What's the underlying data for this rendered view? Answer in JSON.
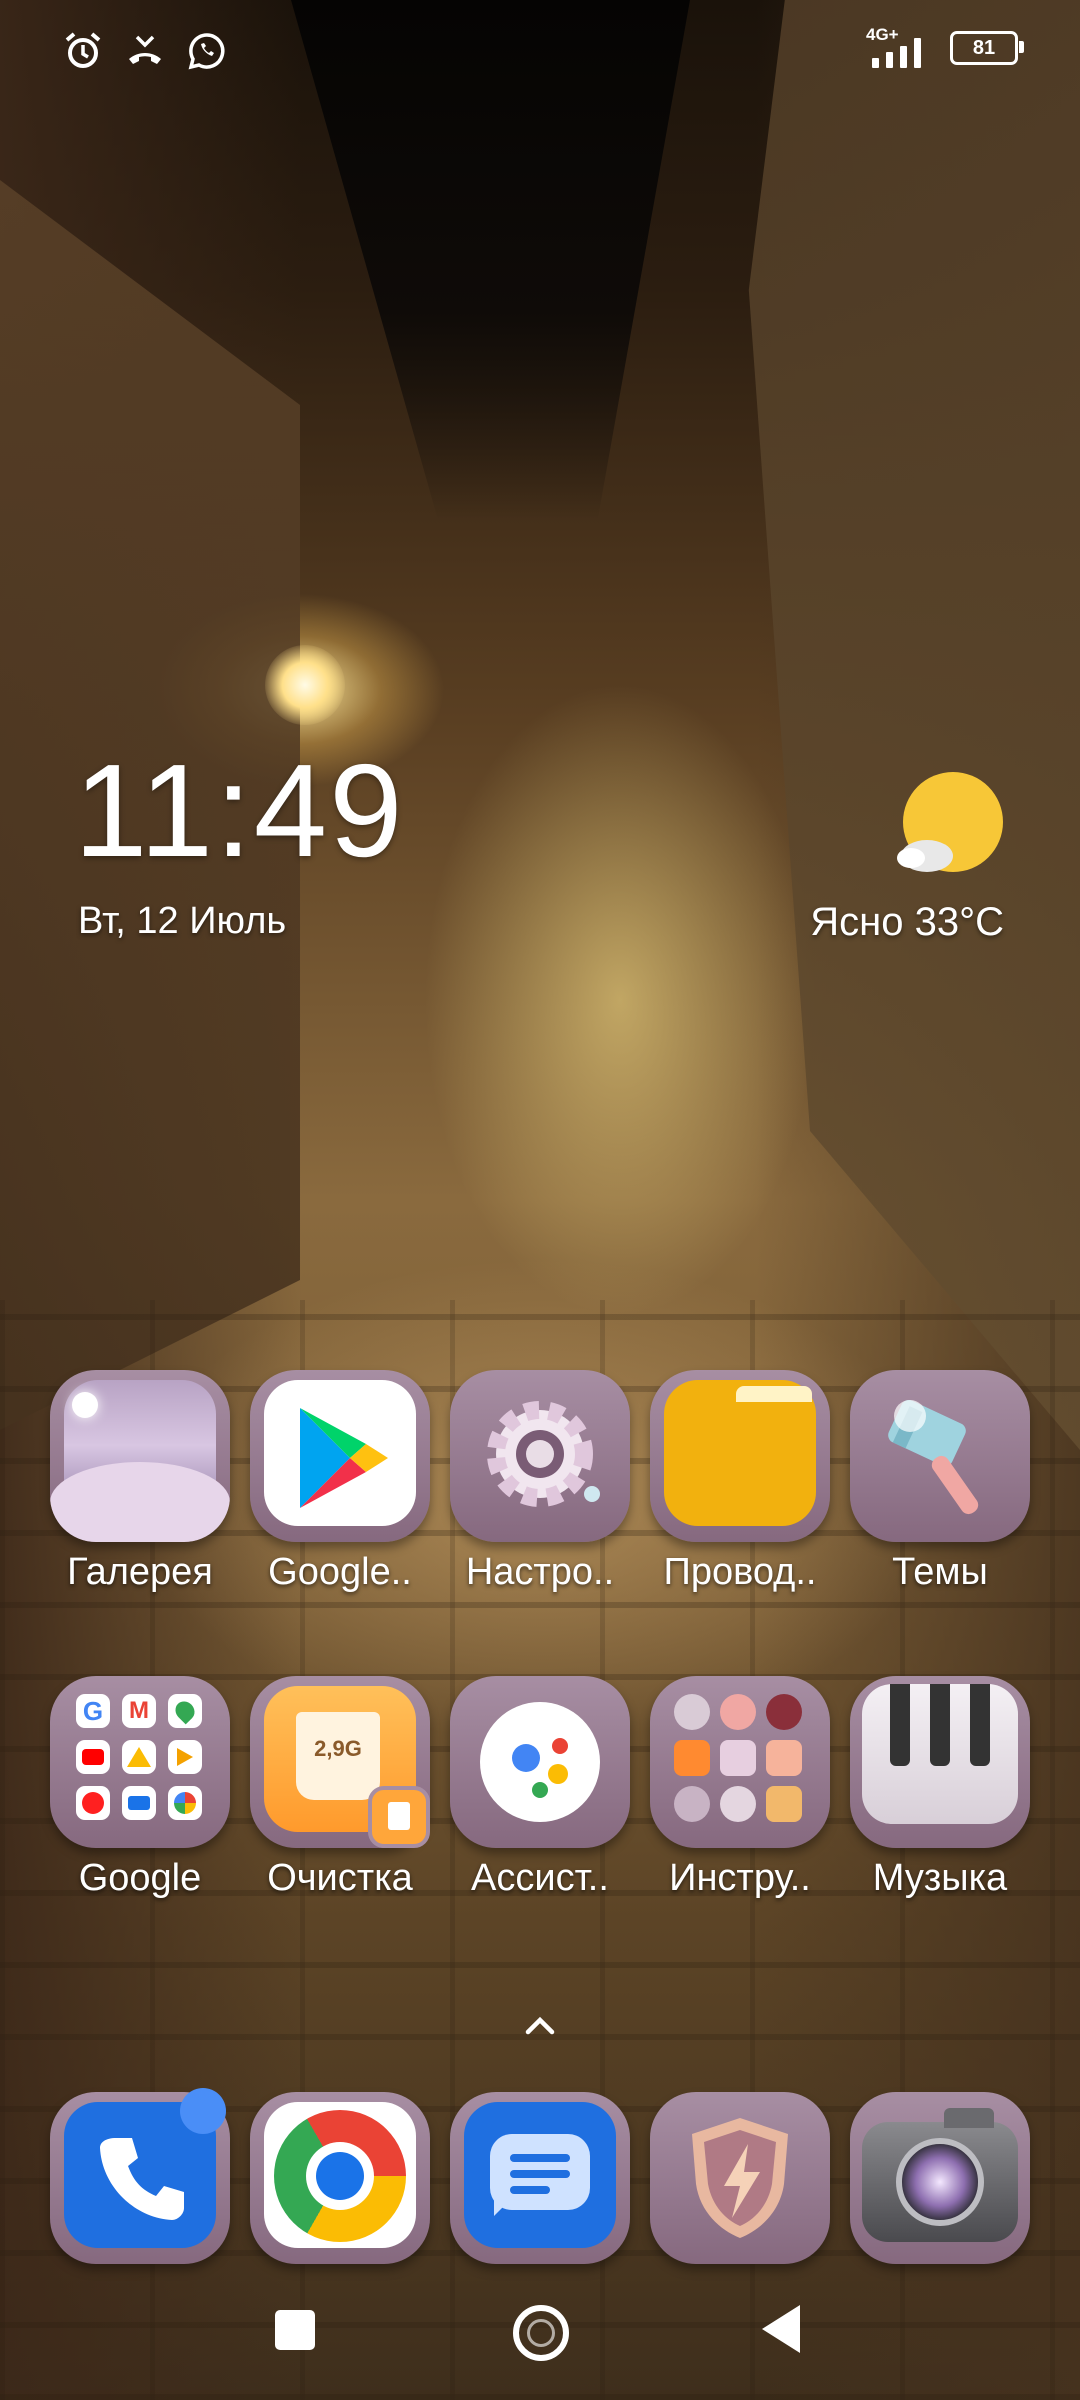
{
  "status_bar": {
    "left_icons": [
      "alarm-icon",
      "missed-call-icon",
      "whatsapp-icon"
    ],
    "network_type": "4G+",
    "battery_level": "81"
  },
  "widget": {
    "time": "11:49",
    "date": "Вт, 12 Июль",
    "weather": "Ясно  33°C",
    "weather_icon": "sun-with-cloud-icon"
  },
  "apps": {
    "row1": [
      {
        "label": "Галерея",
        "icon": "gallery-icon"
      },
      {
        "label": "Google..",
        "icon": "play-store-icon"
      },
      {
        "label": "Настро..",
        "icon": "settings-gear-icon"
      },
      {
        "label": "Провод..",
        "icon": "folder-icon"
      },
      {
        "label": "Темы",
        "icon": "paintbrush-icon"
      }
    ],
    "row2": [
      {
        "label": "Google",
        "icon": "google-folder-icon"
      },
      {
        "label": "Очистка",
        "icon": "cleaner-icon",
        "badge": "2,9G"
      },
      {
        "label": "Ассист..",
        "icon": "assistant-icon"
      },
      {
        "label": "Инстру..",
        "icon": "tools-folder-icon"
      },
      {
        "label": "Музыка",
        "icon": "piano-icon"
      }
    ]
  },
  "dock": [
    "phone-icon",
    "chrome-icon",
    "messages-icon",
    "security-shield-icon",
    "camera-icon"
  ],
  "colors": {
    "tile": "#a78ea3",
    "folder_yellow": "#f2b10e",
    "dock_blue": "#1f6fe0"
  }
}
